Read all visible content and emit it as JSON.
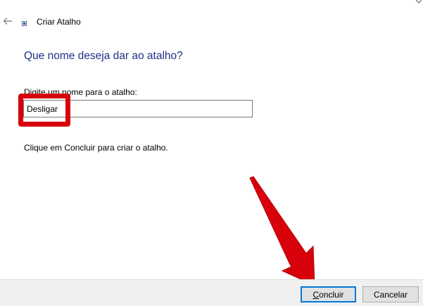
{
  "window": {
    "title": "Criar Atalho",
    "back_icon": "back-arrow-icon",
    "wizard_icon": "shortcut-icon"
  },
  "main": {
    "heading": "Que nome deseja dar ao atalho?",
    "field_label": "Digite um nome para o atalho:",
    "name_value": "Desligar",
    "hint": "Clique em Concluir para criar o atalho."
  },
  "annotations": {
    "highlight_color": "#d8000b",
    "arrow_color": "#d8000b"
  },
  "footer": {
    "finish_accel": "C",
    "finish_rest": "oncluir",
    "cancel_label": "Cancelar"
  },
  "colors": {
    "heading": "#1e3287",
    "footer_bg": "#f0f0f0",
    "default_button_border": "#0078d7"
  }
}
